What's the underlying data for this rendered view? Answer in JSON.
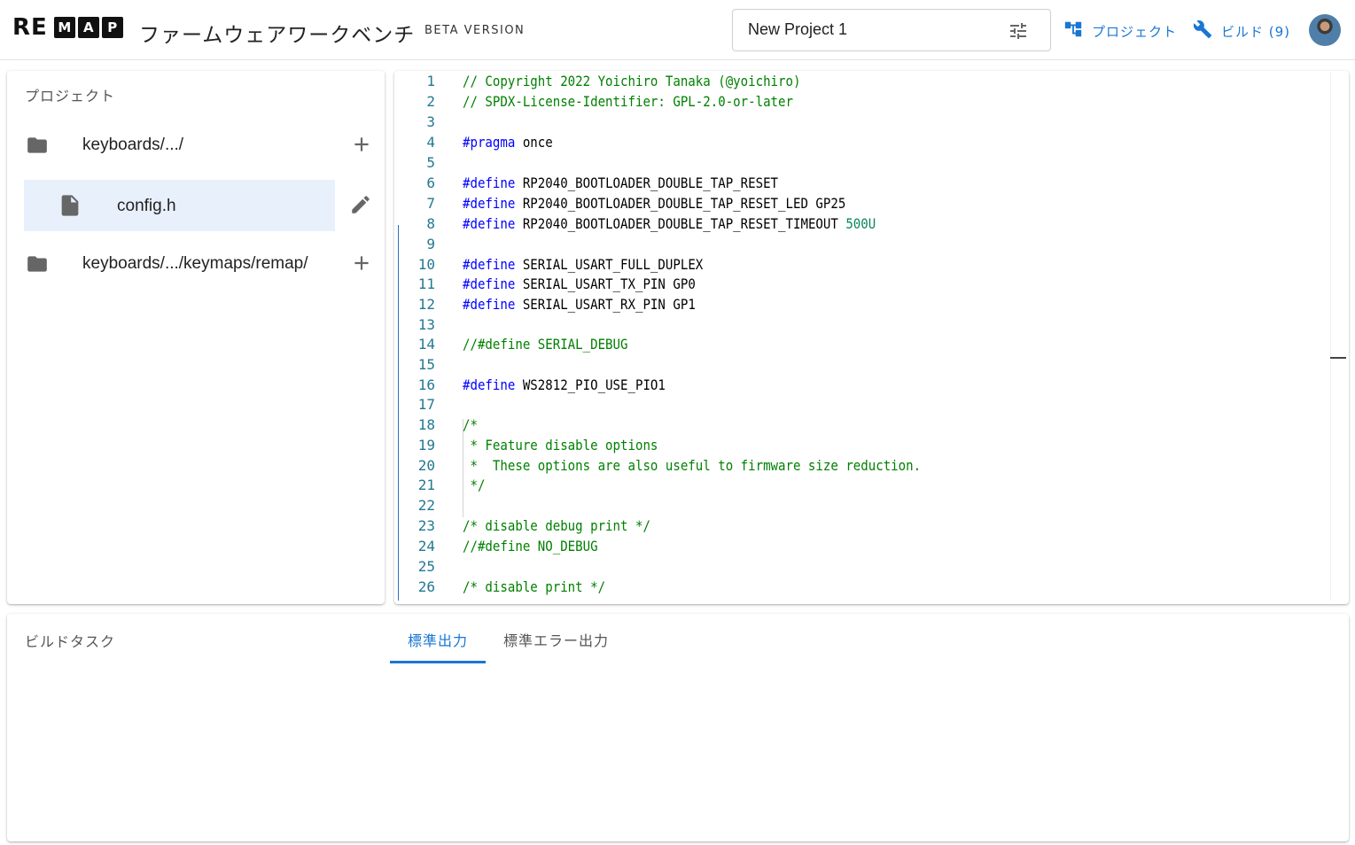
{
  "header": {
    "logo_prefix": "RE",
    "logo_letters": [
      "M",
      "A",
      "P"
    ],
    "title": "ファームウェアワークベンチ",
    "beta": "BETA VERSION",
    "project_name": "New Project 1",
    "nav_project": "プロジェクト",
    "nav_build": "ビルド (9)"
  },
  "sidebar": {
    "title": "プロジェクト",
    "items": [
      {
        "label": "keyboards/.../",
        "icon": "folder-icon",
        "action": "add-icon"
      },
      {
        "label": "config.h",
        "icon": "file-icon",
        "action": "edit-icon",
        "selected": true
      },
      {
        "label": "keyboards/.../keymaps/remap/",
        "icon": "folder-icon",
        "action": "add-icon"
      }
    ]
  },
  "editor": {
    "lines": [
      {
        "n": "1",
        "tokens": [
          {
            "t": "// Copyright 2022 Yoichiro Tanaka (@yoichiro)",
            "c": "comment"
          }
        ]
      },
      {
        "n": "2",
        "tokens": [
          {
            "t": "// SPDX-License-Identifier: GPL-2.0-or-later",
            "c": "comment"
          }
        ]
      },
      {
        "n": "3",
        "tokens": []
      },
      {
        "n": "4",
        "tokens": [
          {
            "t": "#pragma",
            "c": "keyword"
          },
          {
            "t": " once",
            "c": ""
          }
        ]
      },
      {
        "n": "5",
        "tokens": []
      },
      {
        "n": "6",
        "tokens": [
          {
            "t": "#define",
            "c": "keyword"
          },
          {
            "t": " RP2040_BOOTLOADER_DOUBLE_TAP_RESET",
            "c": ""
          }
        ]
      },
      {
        "n": "7",
        "tokens": [
          {
            "t": "#define",
            "c": "keyword"
          },
          {
            "t": " RP2040_BOOTLOADER_DOUBLE_TAP_RESET_LED GP25",
            "c": ""
          }
        ]
      },
      {
        "n": "8",
        "tokens": [
          {
            "t": "#define",
            "c": "keyword"
          },
          {
            "t": " RP2040_BOOTLOADER_DOUBLE_TAP_RESET_TIMEOUT ",
            "c": ""
          },
          {
            "t": "500U",
            "c": "number"
          }
        ]
      },
      {
        "n": "9",
        "tokens": []
      },
      {
        "n": "10",
        "tokens": [
          {
            "t": "#define",
            "c": "keyword"
          },
          {
            "t": " SERIAL_USART_FULL_DUPLEX",
            "c": ""
          }
        ]
      },
      {
        "n": "11",
        "tokens": [
          {
            "t": "#define",
            "c": "keyword"
          },
          {
            "t": " SERIAL_USART_TX_PIN GP0",
            "c": ""
          }
        ]
      },
      {
        "n": "12",
        "tokens": [
          {
            "t": "#define",
            "c": "keyword"
          },
          {
            "t": " SERIAL_USART_RX_PIN GP1",
            "c": ""
          }
        ]
      },
      {
        "n": "13",
        "tokens": []
      },
      {
        "n": "14",
        "tokens": [
          {
            "t": "//#define SERIAL_DEBUG",
            "c": "comment"
          }
        ]
      },
      {
        "n": "15",
        "tokens": []
      },
      {
        "n": "16",
        "tokens": [
          {
            "t": "#define",
            "c": "keyword"
          },
          {
            "t": " WS2812_PIO_USE_PIO1",
            "c": ""
          }
        ]
      },
      {
        "n": "17",
        "tokens": []
      },
      {
        "n": "18",
        "tokens": [
          {
            "t": "/*",
            "c": "comment"
          }
        ]
      },
      {
        "n": "19",
        "tokens": [
          {
            "t": " * Feature disable options",
            "c": "comment"
          }
        ]
      },
      {
        "n": "20",
        "tokens": [
          {
            "t": " *  These options are also useful to firmware size reduction.",
            "c": "comment"
          }
        ]
      },
      {
        "n": "21",
        "tokens": [
          {
            "t": " */",
            "c": "comment"
          }
        ]
      },
      {
        "n": "22",
        "tokens": []
      },
      {
        "n": "23",
        "tokens": [
          {
            "t": "/* disable debug print */",
            "c": "comment"
          }
        ]
      },
      {
        "n": "24",
        "tokens": [
          {
            "t": "//#define NO_DEBUG",
            "c": "comment"
          }
        ]
      },
      {
        "n": "25",
        "tokens": []
      },
      {
        "n": "26",
        "tokens": [
          {
            "t": "/* disable print */",
            "c": "comment"
          }
        ]
      }
    ]
  },
  "build": {
    "title": "ビルドタスク",
    "tabs": [
      {
        "label": "標準出力",
        "active": true
      },
      {
        "label": "標準エラー出力",
        "active": false
      }
    ]
  },
  "colors": {
    "accent": "#1976d2",
    "selected_bg": "#e8f0fb",
    "line_number": "#237893",
    "comment": "#008000",
    "keyword": "#0000ff",
    "number": "#098658"
  }
}
